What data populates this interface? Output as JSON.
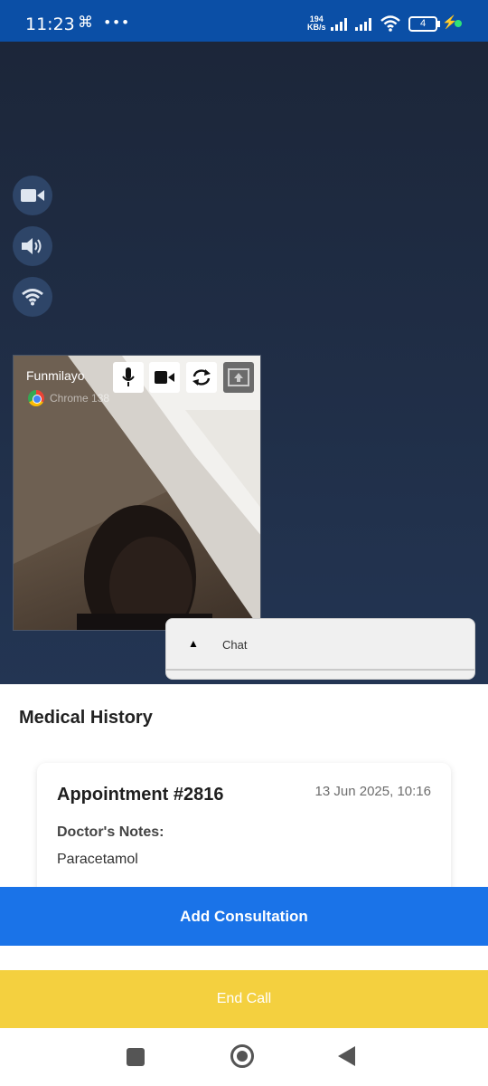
{
  "status_bar": {
    "time": "11:23",
    "left_icons": "⌘ •••",
    "speed_value": "194",
    "speed_unit": "KB/s",
    "battery": "4"
  },
  "video": {
    "side_buttons": [
      "video-camera-icon",
      "speaker-icon",
      "wifi-icon"
    ],
    "preview": {
      "participant_name": "Funmilayo",
      "browser_label": "Chrome 138",
      "controls": [
        "microphone-icon",
        "video-camera-icon",
        "switch-camera-icon",
        "share-screen-icon"
      ]
    }
  },
  "chat": {
    "toggle_symbol": "▲",
    "label": "Chat"
  },
  "medical_history": {
    "title": "Medical History",
    "appointment": {
      "title": "Appointment #2816",
      "date": "13 Jun 2025, 10:16",
      "notes_label": "Doctor's Notes:",
      "notes": "Paracetamol"
    }
  },
  "actions": {
    "add_consultation": "Add Consultation",
    "end_call": "End Call"
  },
  "colors": {
    "status_bar": "#0b4fa6",
    "primary": "#1a73e8",
    "end_call": "#f4d03f"
  }
}
